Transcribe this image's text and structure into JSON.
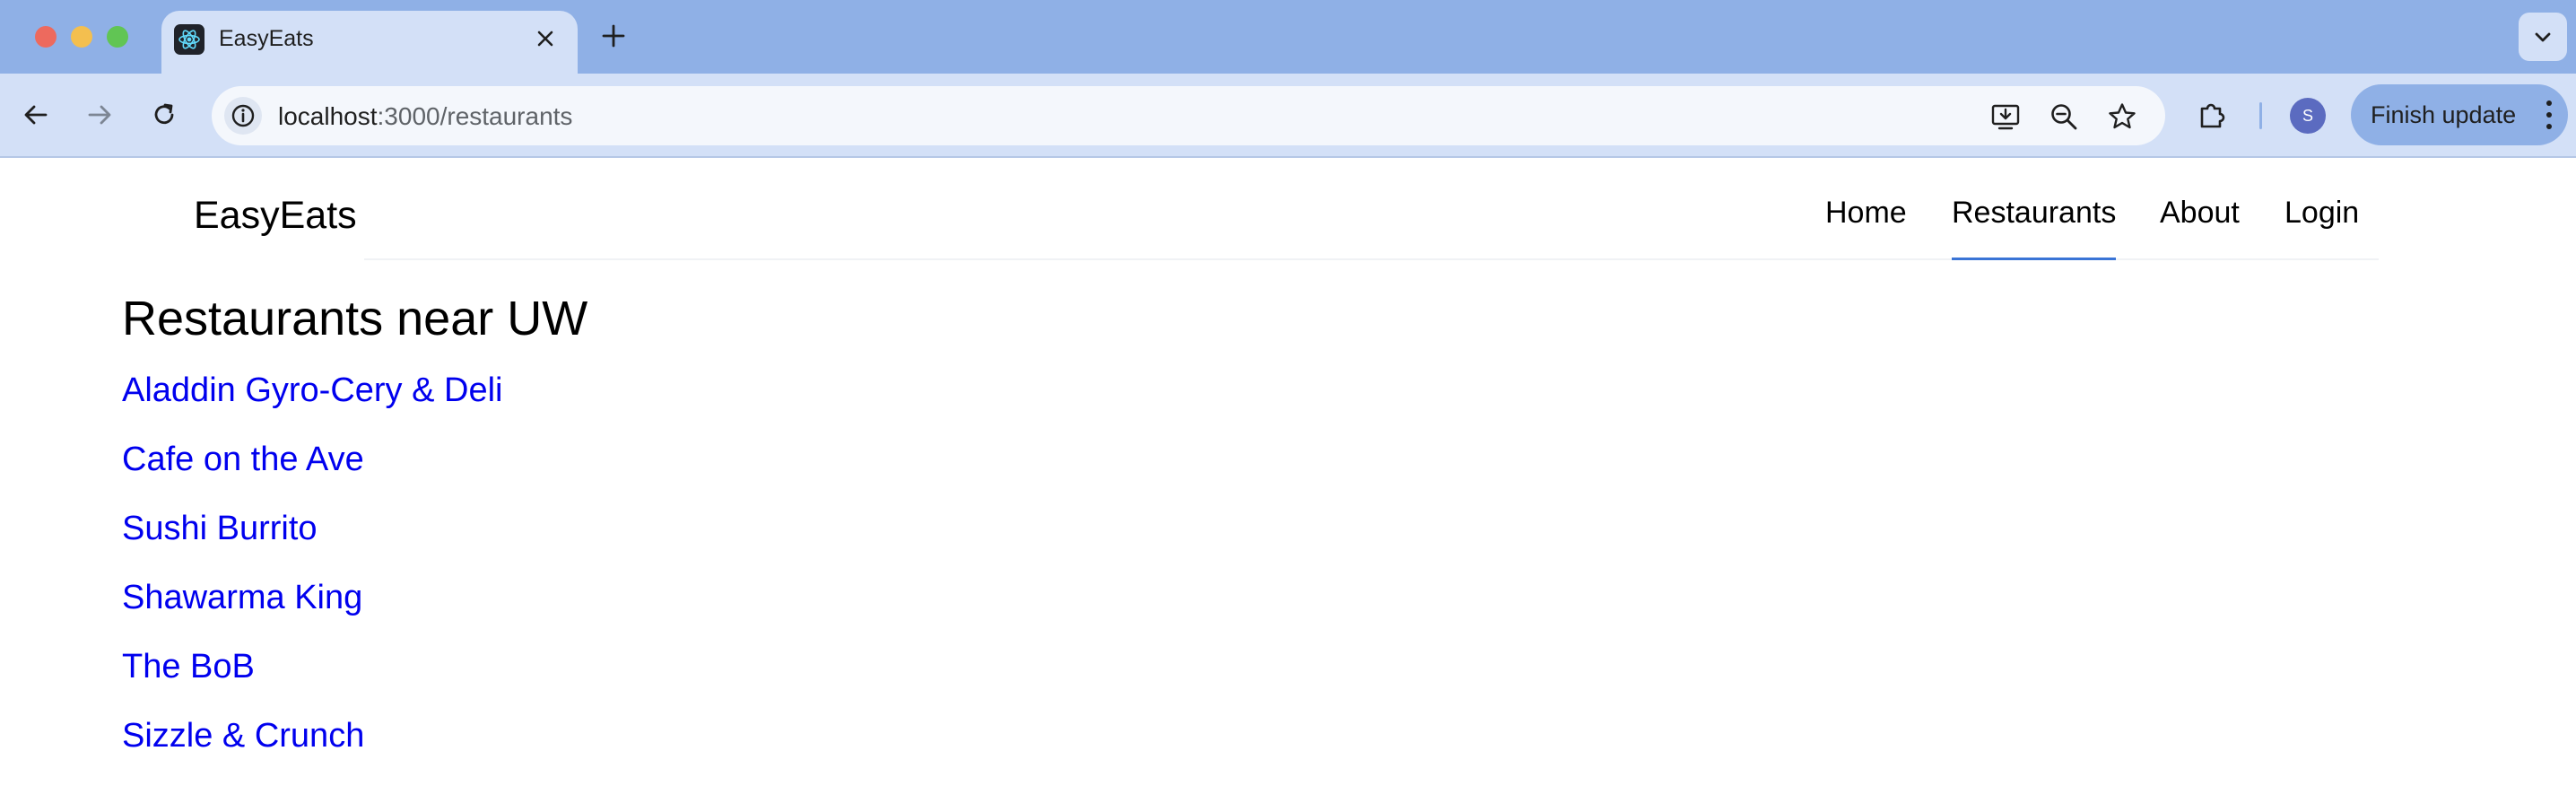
{
  "browser": {
    "tab": {
      "title": "EasyEats"
    },
    "address": {
      "host": "localhost",
      "path": ":3000/restaurants"
    },
    "profile_initial": "S",
    "update_button": "Finish update",
    "icons": {
      "tab_favicon": "react-atom-icon",
      "close": "close-icon",
      "new_tab": "plus-icon",
      "tab_search": "chevron-down-icon",
      "back": "arrow-left-icon",
      "forward": "arrow-right-icon",
      "reload": "reload-icon",
      "site_info": "info-icon",
      "install": "install-app-icon",
      "zoom": "zoom-out-icon",
      "bookmark": "star-icon",
      "extensions": "puzzle-icon",
      "menu": "kebab-menu-icon"
    }
  },
  "app": {
    "brand": "EasyEats",
    "nav": [
      {
        "label": "Home",
        "active": false
      },
      {
        "label": "Restaurants",
        "active": true
      },
      {
        "label": "About",
        "active": false
      },
      {
        "label": "Login",
        "active": false
      }
    ],
    "heading": "Restaurants near UW",
    "restaurants": [
      "Aladdin Gyro-Cery & Deli",
      "Cafe on the Ave",
      "Sushi Burrito",
      "Shawarma King",
      "The BoB",
      "Sizzle & Crunch"
    ]
  },
  "colors": {
    "tabbar": "#8fb0e6",
    "toolbar": "#d3e0f7",
    "link": "#0000ee",
    "nav_active_underline": "#3a74d6"
  }
}
